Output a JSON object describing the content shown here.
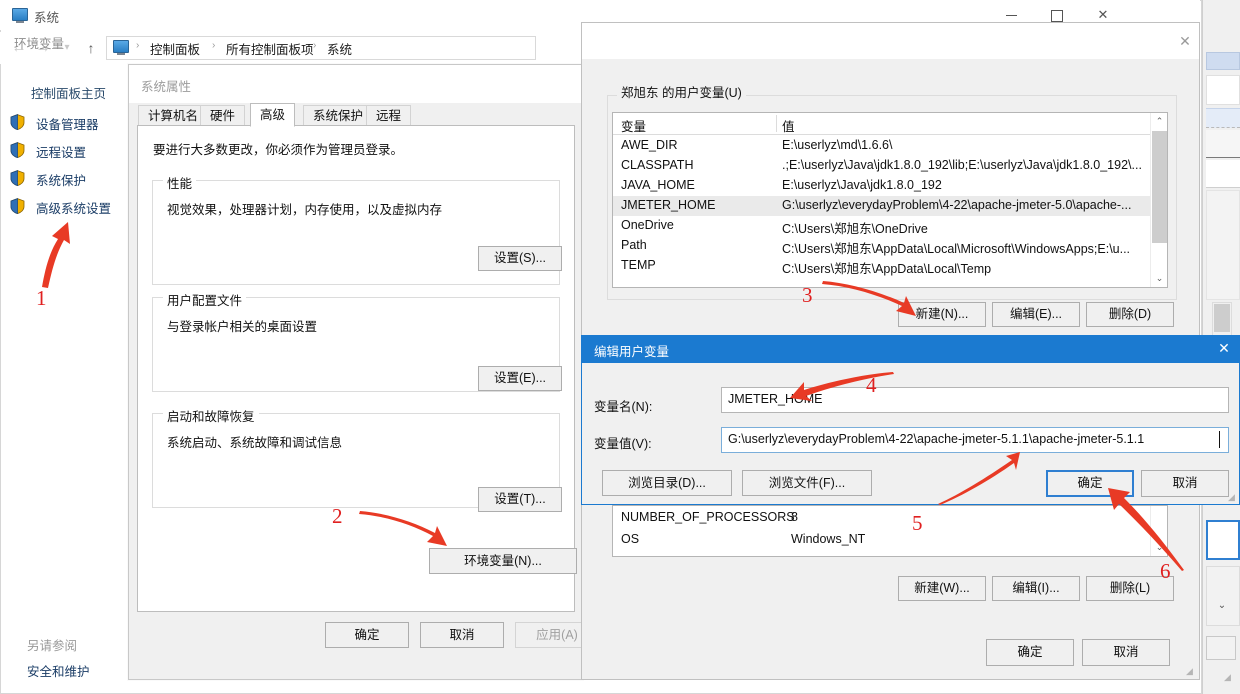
{
  "control_panel": {
    "window_title": "系统",
    "title_icon": "system-monitor-icon",
    "window_buttons": {
      "minimize": "minimize-icon",
      "maximize": "maximize-icon",
      "close": "✕"
    },
    "nav": {
      "back": "←",
      "forward": "→",
      "recent": "▾",
      "up": "↑"
    },
    "breadcrumb": {
      "sep": "›",
      "items": [
        "控制面板",
        "所有控制面板项",
        "系统"
      ]
    },
    "sidebar": {
      "home": "控制面板主页",
      "items": [
        {
          "label": "设备管理器"
        },
        {
          "label": "远程设置"
        },
        {
          "label": "系统保护"
        },
        {
          "label": "高级系统设置"
        }
      ],
      "see_also_title": "另请参阅",
      "see_also_link": "安全和维护"
    }
  },
  "system_properties": {
    "title": "系统属性",
    "tabs": [
      {
        "label": "计算机名",
        "active": false
      },
      {
        "label": "硬件",
        "active": false
      },
      {
        "label": "高级",
        "active": true
      },
      {
        "label": "系统保护",
        "active": false
      },
      {
        "label": "远程",
        "active": false
      }
    ],
    "admin_note": "要进行大多数更改，你必须作为管理员登录。",
    "groups": [
      {
        "title": "性能",
        "desc": "视觉效果，处理器计划，内存使用，以及虚拟内存",
        "button": "设置(S)..."
      },
      {
        "title": "用户配置文件",
        "desc": "与登录帐户相关的桌面设置",
        "button": "设置(E)..."
      },
      {
        "title": "启动和故障恢复",
        "desc": "系统启动、系统故障和调试信息",
        "button": "设置(T)..."
      }
    ],
    "env_button": "环境变量(N)...",
    "footer": {
      "ok": "确定",
      "cancel": "取消",
      "apply": "应用(A)"
    }
  },
  "environment_variables": {
    "title": "环境变量",
    "close": "✕",
    "user_group_legend": "郑旭东 的用户变量(U)",
    "columns": [
      "变量",
      "值"
    ],
    "user_rows": [
      {
        "name": "AWE_DIR",
        "value": "E:\\userlyz\\md\\1.6.6\\",
        "selected": false
      },
      {
        "name": "CLASSPATH",
        "value": ".;E:\\userlyz\\Java\\jdk1.8.0_192\\lib;E:\\userlyz\\Java\\jdk1.8.0_192\\...",
        "selected": false
      },
      {
        "name": "JAVA_HOME",
        "value": "E:\\userlyz\\Java\\jdk1.8.0_192",
        "selected": false
      },
      {
        "name": "JMETER_HOME",
        "value": "G:\\userlyz\\everydayProblem\\4-22\\apache-jmeter-5.0\\apache-...",
        "selected": true
      },
      {
        "name": "OneDrive",
        "value": "C:\\Users\\郑旭东\\OneDrive",
        "selected": false
      },
      {
        "name": "Path",
        "value": "C:\\Users\\郑旭东\\AppData\\Local\\Microsoft\\WindowsApps;E:\\u...",
        "selected": false
      },
      {
        "name": "TEMP",
        "value": "C:\\Users\\郑旭东\\AppData\\Local\\Temp",
        "selected": false
      }
    ],
    "user_buttons": {
      "new": "新建(N)...",
      "edit": "编辑(E)...",
      "delete": "删除(D)"
    },
    "system_rows": [
      {
        "name": "NUMBER_OF_PROCESSORS",
        "value": "8"
      },
      {
        "name": "OS",
        "value": "Windows_NT"
      }
    ],
    "system_buttons": {
      "new": "新建(W)...",
      "edit": "编辑(I)...",
      "delete": "删除(L)"
    },
    "footer": {
      "ok": "确定",
      "cancel": "取消"
    },
    "scroll_up": "⌃",
    "scroll_down": "⌄"
  },
  "edit_user_variable": {
    "title": "编辑用户变量",
    "close": "✕",
    "name_label": "变量名(N):",
    "value_label": "变量值(V):",
    "name_value": "JMETER_HOME",
    "value_value": "G:\\userlyz\\everydayProblem\\4-22\\apache-jmeter-5.1.1\\apache-jmeter-5.1.1",
    "browse_dir": "浏览目录(D)...",
    "browse_file": "浏览文件(F)...",
    "ok": "确定",
    "cancel": "取消"
  },
  "annotations": {
    "color": "#e02020",
    "markers": [
      "1",
      "2",
      "3",
      "4",
      "5",
      "6"
    ]
  }
}
